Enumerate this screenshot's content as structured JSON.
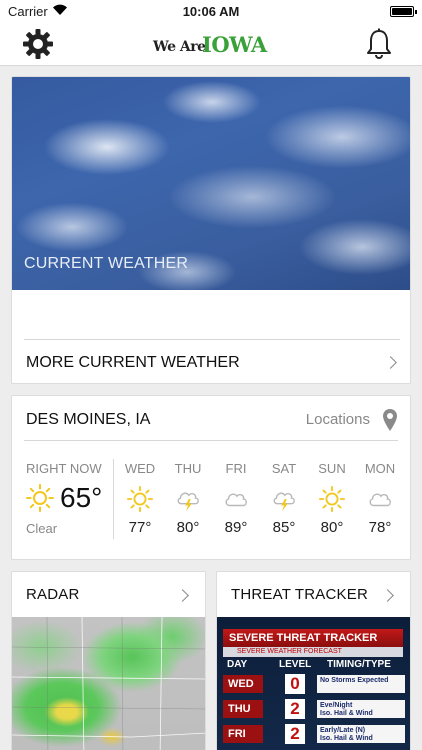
{
  "status_bar": {
    "carrier": "Carrier",
    "time": "10:06 AM"
  },
  "nav": {
    "logo_prefix": "We Are",
    "logo_brand": "IOWA",
    "settings_icon": "gear-icon",
    "notifications_icon": "bell-icon"
  },
  "current_weather": {
    "image_label": "CURRENT WEATHER",
    "more_label": "MORE CURRENT WEATHER"
  },
  "forecast": {
    "city": "DES MOINES, IA",
    "locations_label": "Locations",
    "right_now_label": "RIGHT NOW",
    "current_temp": "65°",
    "current_condition": "Clear",
    "current_icon": "sun-icon",
    "days": [
      {
        "name": "WED",
        "temp": "77°",
        "icon": "sun-icon"
      },
      {
        "name": "THU",
        "temp": "80°",
        "icon": "storm-icon"
      },
      {
        "name": "FRI",
        "temp": "89°",
        "icon": "cloud-icon"
      },
      {
        "name": "SAT",
        "temp": "85°",
        "icon": "storm-icon"
      },
      {
        "name": "SUN",
        "temp": "80°",
        "icon": "sun-icon"
      },
      {
        "name": "MON",
        "temp": "78°",
        "icon": "cloud-icon"
      }
    ]
  },
  "radar": {
    "title": "RADAR"
  },
  "threat_tracker": {
    "title": "THREAT TRACKER",
    "banner": "SEVERE THREAT TRACKER",
    "sub_banner": "SEVERE WEATHER FORECAST",
    "columns": [
      "DAY",
      "LEVEL",
      "TIMING/TYPE"
    ],
    "rows": [
      {
        "day": "WED",
        "level": "0",
        "timing": "No Storms Expected",
        "type": ""
      },
      {
        "day": "THU",
        "level": "2",
        "timing": "Eve/Night",
        "type": "Iso. Hail & Wind"
      },
      {
        "day": "FRI",
        "level": "2",
        "timing": "Early/Late (N)",
        "type": "Iso. Hail & Wind"
      }
    ]
  },
  "colors": {
    "accent_green": "#3aa13a",
    "sun_yellow": "#f2c81e",
    "threat_red": "#9b1010"
  }
}
